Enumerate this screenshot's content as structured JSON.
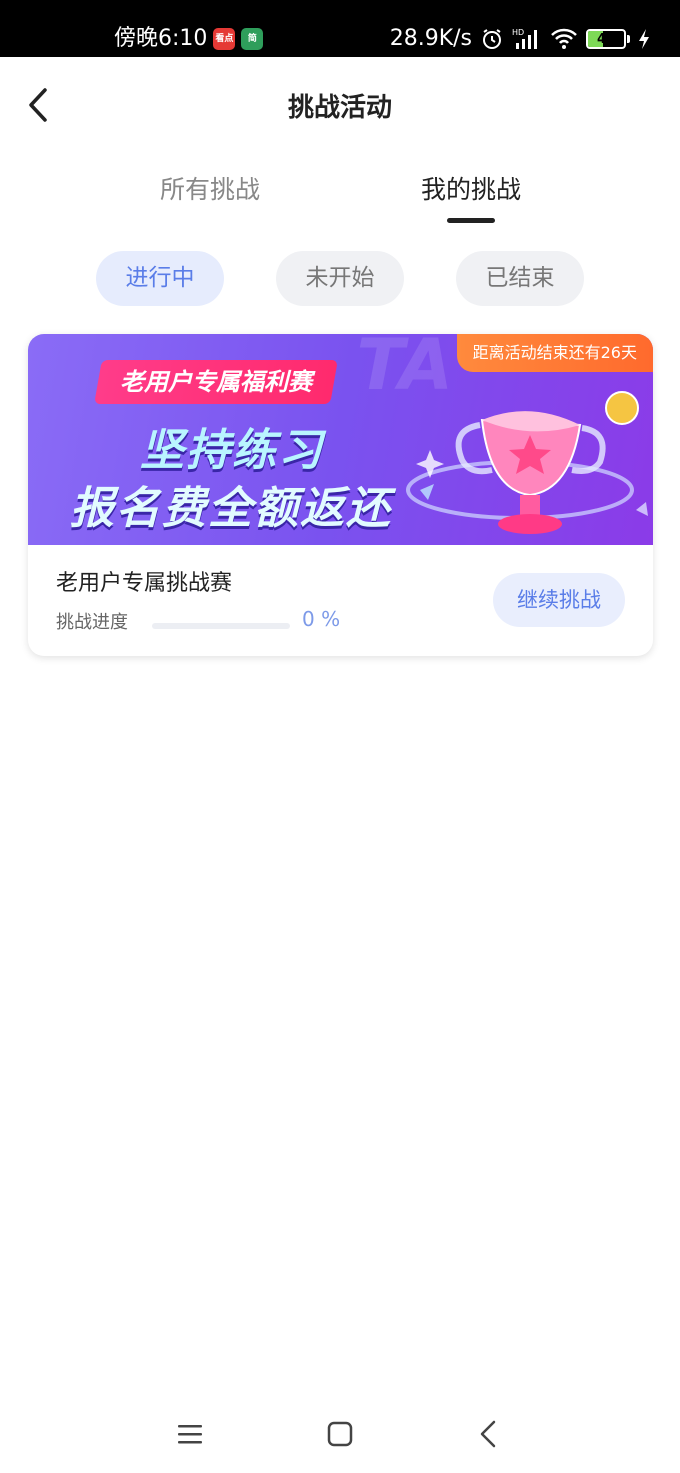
{
  "status_bar": {
    "time": "傍晚6:10",
    "app_badge_1": "看点",
    "app_badge_2": "简",
    "net_speed": "28.9K/s",
    "battery_level": 43,
    "icons": [
      "alarm-icon",
      "hd-signal-icon",
      "wifi-icon",
      "battery-icon",
      "charging-icon"
    ]
  },
  "header": {
    "title": "挑战活动",
    "back_icon": "chevron-left-icon"
  },
  "tabs": [
    {
      "label": "所有挑战",
      "active": false
    },
    {
      "label": "我的挑战",
      "active": true
    }
  ],
  "filters": [
    {
      "label": "进行中",
      "active": true
    },
    {
      "label": "未开始",
      "active": false
    },
    {
      "label": "已结束",
      "active": false
    }
  ],
  "card": {
    "countdown": "距离活动结束还有26天",
    "ribbon": "老用户专属福利赛",
    "headline_1": "坚持练习",
    "headline_2": "报名费全额返还",
    "name": "老用户专属挑战赛",
    "progress_label": "挑战进度",
    "progress_value": "0 %",
    "progress_fraction": 0,
    "button": "继续挑战"
  },
  "colors": {
    "accent": "#5a7de8",
    "banner_start": "#8a6cf6",
    "banner_end": "#8b3be8",
    "countdown": "#ff7a34",
    "ribbon": "#ff2a6d"
  },
  "navbar": {
    "icons": [
      "menu-icon",
      "home-square-icon",
      "back-triangle-icon"
    ]
  }
}
